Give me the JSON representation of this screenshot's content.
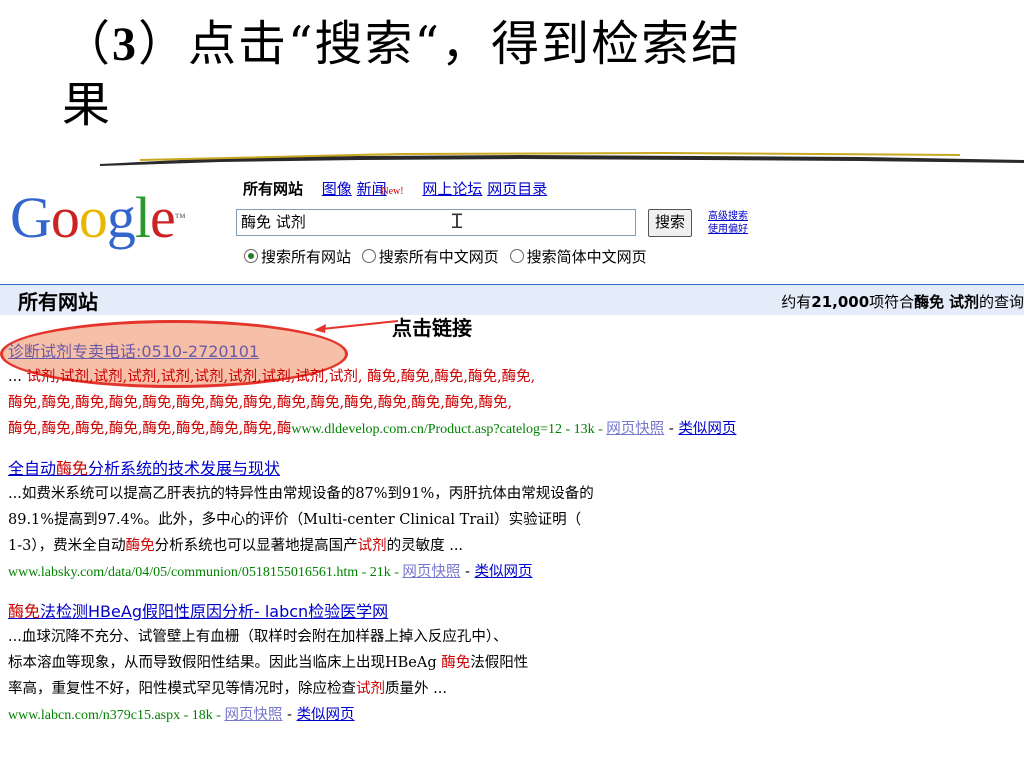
{
  "slide": {
    "title_prefix": "（",
    "title_num": "3",
    "title_line1": "）点击“搜索“，得到检索结",
    "title_line2": "果",
    "callout": "点击链接"
  },
  "google": {
    "logo": "Google",
    "tabs": {
      "active": "所有网站",
      "images": "图像",
      "news": "新闻",
      "new_badge": "New!",
      "forums": "网上论坛",
      "directory": "网页目录"
    },
    "query": "酶免 试剂",
    "search_button": "搜索",
    "advanced": "高级搜索",
    "preferences": "使用偏好",
    "radios": [
      "搜索所有网站",
      "搜索所有中文网页",
      "搜索简体中文网页"
    ],
    "bar_label": "所有网站",
    "count_pre": "约有",
    "count_num": "21,000",
    "count_mid": "项符合",
    "count_q1": "酶免",
    "count_q2": "试剂",
    "count_post": "的查询"
  },
  "results": [
    {
      "title": "诊断试剂专卖电话:0510-2720101",
      "l1a": "...",
      "l1b": "试剂,试剂,试剂,试剂,试剂,试剂,试剂,试剂,试剂,试剂,",
      "l1c": "酶免,酶免,酶免,酶免,酶免,",
      "l2": "酶免,酶免,酶免,酶免,酶免,酶免,酶免,酶免,酶免,酶免,酶免,酶免,酶免,酶免,酶免,",
      "l3": "酶免,酶免,酶免,酶免,酶免,酶免,酶免,酶免,酶",
      "url": "www.dldevelop.com.cn/Product.asp?catelog=12 - 13k - ",
      "cache": "网页快照",
      "similar": "类似网页"
    },
    {
      "title_a": "全自动",
      "title_b": "酶免",
      "title_c": "分析系统的技术发展与现状",
      "l1": "...如费米系统可以提高乙肝表抗的特异性由常规设备的87%到91%，丙肝抗体由常规设备的",
      "l2": "89.1%提高到97.4%。此外，多中心的评价（Multi-center Clinical Trail）实验证明（",
      "l3a": "1-3），费米全自动",
      "l3b": "酶免",
      "l3c": "分析系统也可以显著地提高国产",
      "l3d": "试剂",
      "l3e": "的灵敏度 ...",
      "url": "www.labsky.com/data/04/05/communion/0518155016561.htm - 21k - ",
      "cache": "网页快照",
      "similar": "类似网页"
    },
    {
      "title_a": "酶免",
      "title_b": "法检测HBeAg假阳性原因分析- labcn检验医学网",
      "l1": "...血球沉降不充分、试管壁上有血栅（取样时会附在加样器上掉入反应孔中）、",
      "l2a": "标本溶血等现象，从而导致假阳性结果。因此当临床上出现HBeAg ",
      "l2b": "酶免",
      "l2c": "法假阳性",
      "l3a": "率高，重复性不好，阳性模式罕见等情况时，除应检查",
      "l3b": "试剂",
      "l3c": "质量外 ...",
      "url": "www.labcn.com/n379c15.aspx - 18k - ",
      "cache": "网页快照",
      "similar": "类似网页"
    }
  ],
  "colors": {
    "link": "#0000cc",
    "highlight": "#cc0000",
    "url": "#008000",
    "ellipse_fill": "#f6bfa8",
    "ellipse_stroke": "#e4342b",
    "bar": "#e5ecf9"
  }
}
